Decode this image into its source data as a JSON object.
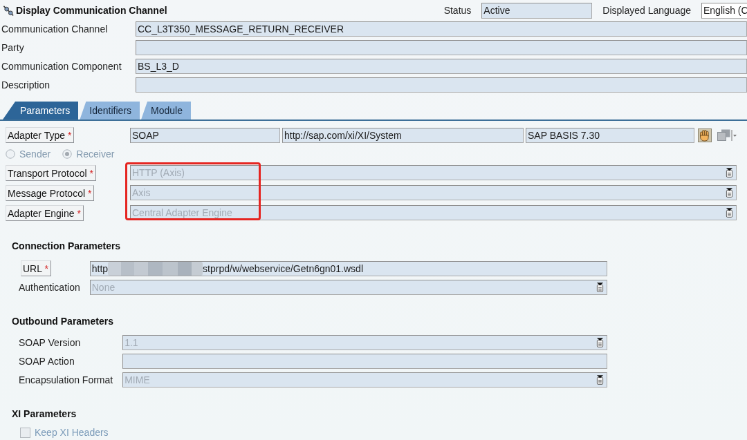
{
  "window": {
    "title": "Display Communication Channel"
  },
  "header": {
    "status_label": "Status",
    "status": "Active",
    "language_label": "Displayed Language",
    "language": "English (C"
  },
  "general": [
    {
      "label": "Communication Channel",
      "value": "CC_L3T350_MESSAGE_RETURN_RECEIVER"
    },
    {
      "label": "Party"
    },
    {
      "label": "Communication Component",
      "value": "BS_L3_D"
    },
    {
      "label": "Description"
    }
  ],
  "tabs": [
    {
      "label": "Parameters",
      "selected": true
    },
    {
      "label": "Identifiers",
      "selected": false
    },
    {
      "label": "Module",
      "selected": false
    }
  ],
  "adapter_type": {
    "label": {
      "kind": "button",
      "text": "Adapter Type",
      "mark": "*"
    },
    "values": [
      "SOAP",
      "http://sap.com/xi/XI/System",
      "SAP BASIS 7.30"
    ]
  },
  "direction": [
    {
      "label": "Sender",
      "selected": false,
      "disabled": true
    },
    {
      "label": "Receiver",
      "selected": true,
      "disabled": true
    }
  ],
  "protocol_fields": [
    {
      "label": {
        "kind": "button",
        "text": "Transport Protocol",
        "mark": "*"
      },
      "kind": "dropdown",
      "value": "HTTP (Axis)",
      "disabled": true
    },
    {
      "label": {
        "kind": "button",
        "text": "Message Protocol",
        "mark": "*"
      },
      "kind": "dropdown",
      "value": "Axis",
      "disabled": true
    },
    {
      "label": {
        "kind": "button",
        "text": "Adapter Engine",
        "mark": "*"
      },
      "kind": "dropdown",
      "value": "Central Adapter Engine",
      "disabled": true
    }
  ],
  "sections": [
    {
      "title": "Connection Parameters",
      "fields": [
        {
          "label": {
            "kind": "button",
            "text": "URL",
            "mark": "*"
          },
          "kind": "text",
          "value_parts": [
            "http",
            "stprpd/w/webservice/Getn6gn01.wsdl"
          ],
          "disabled": false
        },
        {
          "label": {
            "kind": "plain",
            "text": "Authentication"
          },
          "kind": "dropdown",
          "value": "None",
          "disabled": true
        }
      ]
    },
    {
      "title": "Outbound Parameters",
      "fields": [
        {
          "label": {
            "kind": "plain",
            "text": "SOAP Version"
          },
          "kind": "dropdown",
          "value": "1.1",
          "disabled": true
        },
        {
          "label": {
            "kind": "plain",
            "text": "SOAP Action"
          },
          "kind": "text"
        },
        {
          "label": {
            "kind": "plain",
            "text": "Encapsulation Format"
          },
          "kind": "dropdown",
          "value": "MIME",
          "disabled": true
        }
      ]
    },
    {
      "title": "XI Parameters",
      "checkboxes": [
        {
          "label": "Keep XI Headers",
          "checked": false,
          "disabled": true
        }
      ]
    }
  ]
}
